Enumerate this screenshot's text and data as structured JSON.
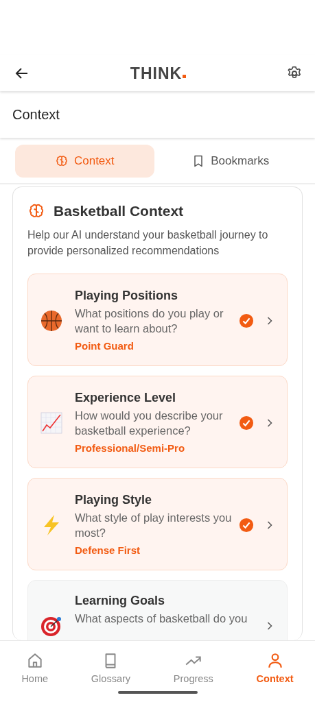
{
  "header": {
    "logo": "THINK"
  },
  "page_title": "Context",
  "tabs": [
    {
      "label": "Context",
      "selected": true,
      "kind": "brain"
    },
    {
      "label": "Bookmarks",
      "selected": false,
      "kind": "bookmark"
    }
  ],
  "section": {
    "title": "Basketball Context",
    "description": "Help our AI understand your basketball journey to provide personalized recommendations"
  },
  "items": [
    {
      "kind": "basketball",
      "title": "Playing Positions",
      "question": "What positions do you play or want to learn about?",
      "answer": "Point Guard",
      "completed": true
    },
    {
      "kind": "chart",
      "title": "Experience Level",
      "question": "How would you describe your basketball experience?",
      "answer": "Professional/Semi-Pro",
      "completed": true
    },
    {
      "kind": "lightning",
      "title": "Playing Style",
      "question": "What style of play interests you most?",
      "answer": "Defense First",
      "completed": true
    },
    {
      "kind": "target",
      "title": "Learning Goals",
      "question": "What aspects of basketball do you",
      "completed": false
    }
  ],
  "nav": [
    {
      "kind": "home",
      "label": "Home",
      "selected": false
    },
    {
      "kind": "book",
      "label": "Glossary",
      "selected": false
    },
    {
      "kind": "trend",
      "label": "Progress",
      "selected": false
    },
    {
      "kind": "person",
      "label": "Context",
      "selected": true
    }
  ]
}
